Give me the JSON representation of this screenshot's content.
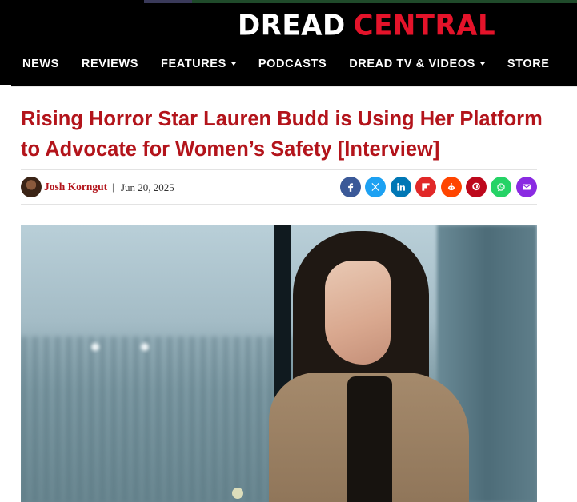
{
  "site": {
    "logo_word1": "DREAD",
    "logo_word2": "CENTRAL",
    "colors": {
      "brand_red": "#e4132a",
      "header_bg": "#000000",
      "link_red": "#b3141b"
    }
  },
  "nav": {
    "items": [
      {
        "label": "NEWS",
        "dropdown": false
      },
      {
        "label": "REVIEWS",
        "dropdown": false
      },
      {
        "label": "FEATURES",
        "dropdown": true
      },
      {
        "label": "PODCASTS",
        "dropdown": false
      },
      {
        "label": "DREAD TV & VIDEOS",
        "dropdown": true
      },
      {
        "label": "STORE",
        "dropdown": false
      }
    ]
  },
  "article": {
    "headline": "Rising Horror Star Lauren Budd is Using Her Platform to Advocate for Women’s Safety [Interview]",
    "author": "Josh Korngut",
    "separator": "|",
    "date": "Jun 20, 2025"
  },
  "share": [
    {
      "icon": "facebook-icon",
      "glyph": "f",
      "color": "#3b5998"
    },
    {
      "icon": "x-twitter-icon",
      "glyph": "𝕏",
      "color": "#1da1f2"
    },
    {
      "icon": "linkedin-icon",
      "glyph": "in",
      "color": "#0077b5"
    },
    {
      "icon": "flipboard-icon",
      "glyph": "F",
      "color": "#e12828"
    },
    {
      "icon": "reddit-icon",
      "glyph": "●",
      "color": "#ff4500"
    },
    {
      "icon": "pinterest-icon",
      "glyph": "P",
      "color": "#bd081c"
    },
    {
      "icon": "whatsapp-icon",
      "glyph": "✆",
      "color": "#25d366"
    },
    {
      "icon": "email-icon",
      "glyph": "✉",
      "color": "#8a2be2"
    }
  ]
}
